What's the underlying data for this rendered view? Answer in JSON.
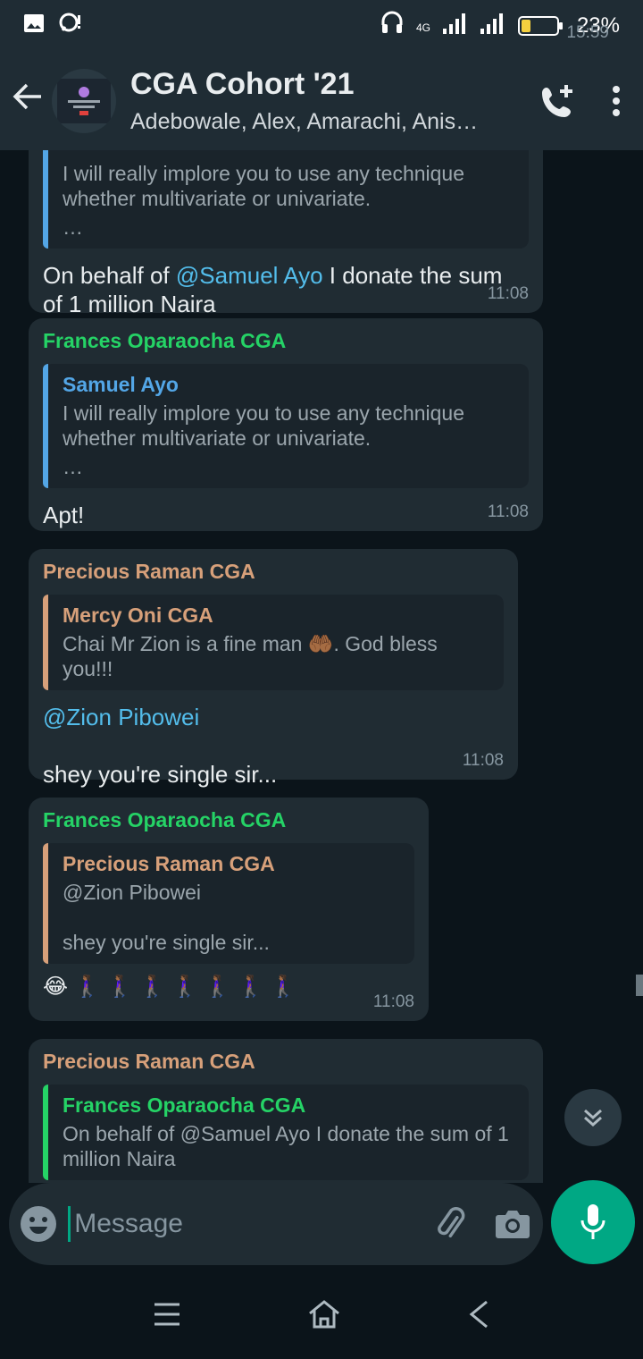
{
  "status_bar": {
    "time": "15:59",
    "network": "4G",
    "battery": "23%",
    "battery_level": 0.23
  },
  "header": {
    "title": "CGA Cohort '21",
    "subtitle": "Adebowale, Alex, Amarachi, Anis…"
  },
  "messages": [
    {
      "quote_text_1": "I will really implore you to use any technique",
      "quote_text_2": "whether multivariate or univariate.",
      "quote_more": "…",
      "text_before": "On behalf of ",
      "mention": "@Samuel Ayo",
      "text_after": " I donate the sum of 1 million Naira",
      "time": "11:08"
    },
    {
      "sender": "Frances Oparaocha CGA",
      "quote_name": "Samuel Ayo",
      "quote_text_1": "I will really implore you to use any technique",
      "quote_text_2": "whether multivariate or univariate.",
      "quote_more": "…",
      "text": "Apt!",
      "time": "11:08"
    },
    {
      "sender": "Precious Raman CGA",
      "quote_name": "Mercy Oni CGA",
      "quote_text": "Chai Mr Zion is a fine man 🤲🏾. God bless you!!!",
      "mention": "@Zion Pibowei",
      "text": "shey you're single sir...",
      "time": "11:08"
    },
    {
      "sender": "Frances Oparaocha CGA",
      "quote_name": "Precious Raman CGA",
      "quote_text_1": "@Zion Pibowei",
      "quote_text_2": "shey you're single sir...",
      "text": "😂 🚶🏾‍♀️ 🚶🏾‍♀️ 🚶🏾‍♀️ 🚶🏾‍♀️ 🚶🏾‍♀️ 🚶🏾‍♀️ 🚶🏾‍♀️",
      "time": "11:08"
    },
    {
      "sender": "Precious Raman CGA",
      "quote_name": "Frances Oparaocha CGA",
      "quote_text": "On behalf of @Samuel Ayo I donate the sum of 1 million Naira"
    }
  ],
  "composer": {
    "placeholder": "Message"
  },
  "colors": {
    "accent": "#00a884",
    "bubble": "#202c33",
    "background": "#0b141a"
  }
}
